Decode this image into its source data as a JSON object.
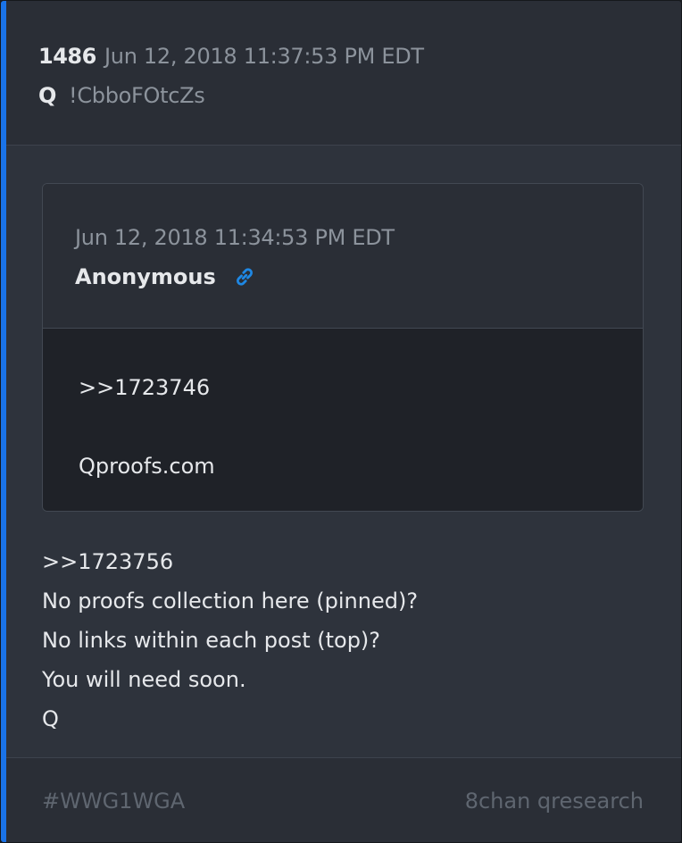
{
  "post": {
    "number": "1486",
    "timestamp": "Jun 12, 2018 11:37:53 PM EDT",
    "author": "Q",
    "tripcode": "!CbboFOtcZs"
  },
  "quoted_post": {
    "timestamp": "Jun 12, 2018 11:34:53 PM EDT",
    "author": "Anonymous",
    "link_icon": "link-icon",
    "lines": [
      ">>1723746",
      "Qproofs.com"
    ]
  },
  "body": {
    "lines": [
      ">>1723756",
      "No proofs collection here (pinned)?",
      "No links within each post (top)?",
      "You will need soon.",
      "Q"
    ]
  },
  "footer": {
    "hashtag": "#WWG1WGA",
    "source": "8chan qresearch"
  },
  "colors": {
    "accent": "#1a73e8",
    "link": "#1e88e5",
    "background": "#2e333c"
  }
}
